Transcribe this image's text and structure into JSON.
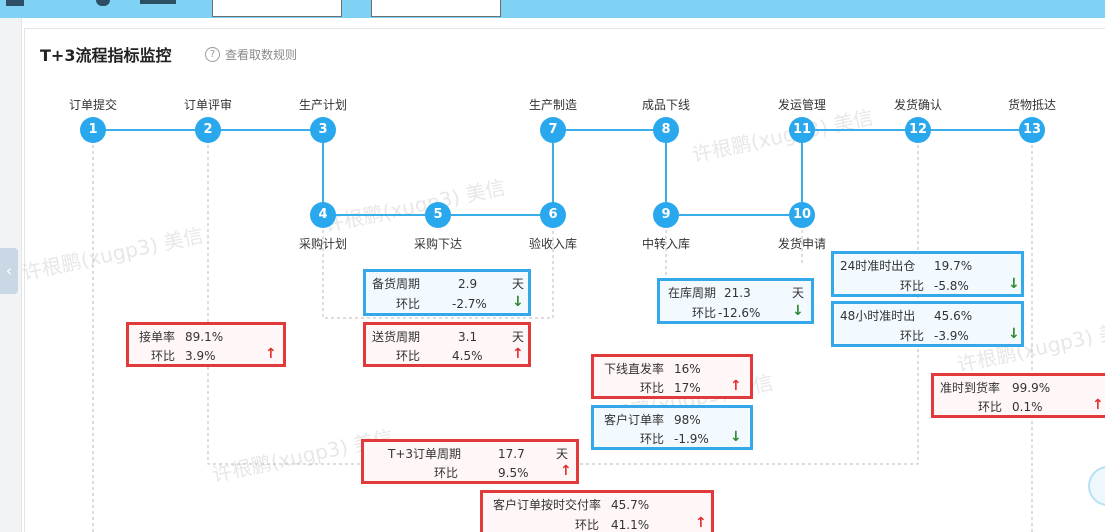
{
  "header": {
    "title": "T+3流程指标监控",
    "rule_link": "查看取数规则",
    "help_icon": "?"
  },
  "nodes": [
    {
      "num": "1",
      "label": "订单提交"
    },
    {
      "num": "2",
      "label": "订单评审"
    },
    {
      "num": "3",
      "label": "生产计划"
    },
    {
      "num": "4",
      "label": "采购计划"
    },
    {
      "num": "5",
      "label": "采购下达"
    },
    {
      "num": "6",
      "label": "验收入库"
    },
    {
      "num": "7",
      "label": "生产制造"
    },
    {
      "num": "8",
      "label": "成品下线"
    },
    {
      "num": "9",
      "label": "中转入库"
    },
    {
      "num": "10",
      "label": "发货申请"
    },
    {
      "num": "11",
      "label": "发运管理"
    },
    {
      "num": "12",
      "label": "发货确认"
    },
    {
      "num": "13",
      "label": "货物抵达"
    }
  ],
  "metrics": {
    "bh": {
      "name": "备货周期",
      "value": "2.9",
      "unit": "天",
      "ratio_label": "环比",
      "ratio": "-2.7%",
      "trend": "down"
    },
    "sh": {
      "name": "送货周期",
      "value": "3.1",
      "unit": "天",
      "ratio_label": "环比",
      "ratio": "4.5%",
      "trend": "up"
    },
    "jd": {
      "name": "接单率",
      "value": "89.1%",
      "ratio_label": "环比",
      "ratio": "3.9%",
      "trend": "up"
    },
    "zk": {
      "name": "在库周期",
      "value": "21.3",
      "unit": "天",
      "ratio_label": "环比",
      "ratio": "-12.6%",
      "trend": "down"
    },
    "xx": {
      "name": "下线直发率",
      "value": "16%",
      "ratio_label": "环比",
      "ratio": "17%",
      "trend": "up"
    },
    "kh": {
      "name": "客户订单率",
      "value": "98%",
      "ratio_label": "环比",
      "ratio": "-1.9%",
      "trend": "down"
    },
    "h24": {
      "name": "24时准时出仓",
      "value": "19.7%",
      "ratio_label": "环比",
      "ratio": "-5.8%",
      "trend": "down"
    },
    "h48": {
      "name": "48小时准时出",
      "value": "45.6%",
      "ratio_label": "环比",
      "ratio": "-3.9%",
      "trend": "down"
    },
    "zs": {
      "name": "准时到货率",
      "value": "99.9%",
      "ratio_label": "环比",
      "ratio": "0.1%",
      "trend": "up"
    },
    "t3": {
      "name": "T+3订单周期",
      "value": "17.7",
      "unit": "天",
      "ratio_label": "环比",
      "ratio": "9.5%",
      "trend": "up"
    },
    "ks": {
      "name": "客户订单按时交付率",
      "value": "45.7%",
      "ratio_label": "环比",
      "ratio": "41.1%",
      "trend": "up"
    }
  },
  "arrows": {
    "up": "↑",
    "down": "↓"
  },
  "left_tab": "‹",
  "watermark": "许根鹏(xugp3) 美信",
  "colors": {
    "node": "#2aa8ee",
    "line": "#3aaee8",
    "red_box": "#e23a3a",
    "blue_box": "#35a8ea",
    "up": "#e0312d",
    "down": "#2e8a2e"
  }
}
